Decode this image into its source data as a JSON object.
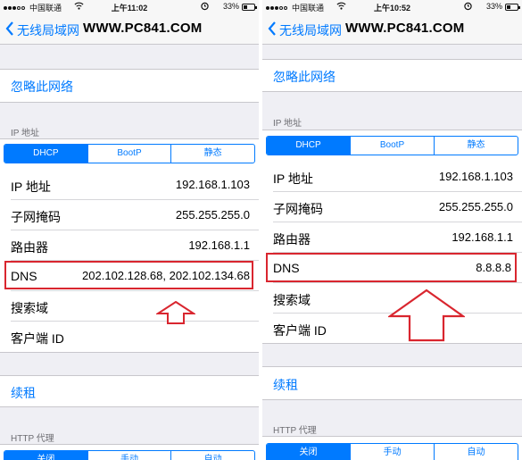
{
  "left": {
    "status": {
      "carrier": "中国联通",
      "time": "上午11:02",
      "battery": "33%"
    },
    "nav": {
      "back_label": "无线局域网",
      "title": "WWW.PC841.COM"
    },
    "forget_label": "忽略此网络",
    "ip_header": "IP 地址",
    "ip_tabs": [
      "DHCP",
      "BootP",
      "静态"
    ],
    "rows": [
      {
        "label": "IP 地址",
        "value": "192.168.1.103"
      },
      {
        "label": "子网掩码",
        "value": "255.255.255.0"
      },
      {
        "label": "路由器",
        "value": "192.168.1.1"
      },
      {
        "label": "DNS",
        "value": "202.102.128.68, 202.102.134.68"
      },
      {
        "label": "搜索域",
        "value": ""
      },
      {
        "label": "客户端 ID",
        "value": ""
      }
    ],
    "renew_label": "续租",
    "http_header": "HTTP 代理",
    "http_tabs": [
      "关闭",
      "手动",
      "自动"
    ]
  },
  "right": {
    "status": {
      "carrier": "中国联通",
      "time": "上午10:52",
      "battery": "33%"
    },
    "nav": {
      "back_label": "无线局域网",
      "title": "WWW.PC841.COM"
    },
    "forget_label": "忽略此网络",
    "ip_header": "IP 地址",
    "ip_tabs": [
      "DHCP",
      "BootP",
      "静态"
    ],
    "rows": [
      {
        "label": "IP 地址",
        "value": "192.168.1.103"
      },
      {
        "label": "子网掩码",
        "value": "255.255.255.0"
      },
      {
        "label": "路由器",
        "value": "192.168.1.1"
      },
      {
        "label": "DNS",
        "value": "8.8.8.8"
      },
      {
        "label": "搜索域",
        "value": ""
      },
      {
        "label": "客户端 ID",
        "value": ""
      }
    ],
    "renew_label": "续租",
    "http_header": "HTTP 代理",
    "http_tabs": [
      "关闭",
      "手动",
      "自动"
    ]
  },
  "colors": {
    "accent": "#007aff",
    "highlight": "#d9262f",
    "background": "#efeff4"
  },
  "icons": [
    "signal-dots-icon",
    "wifi-icon",
    "lock-icon",
    "battery-icon",
    "back-chevron-icon",
    "up-arrow-icon"
  ]
}
